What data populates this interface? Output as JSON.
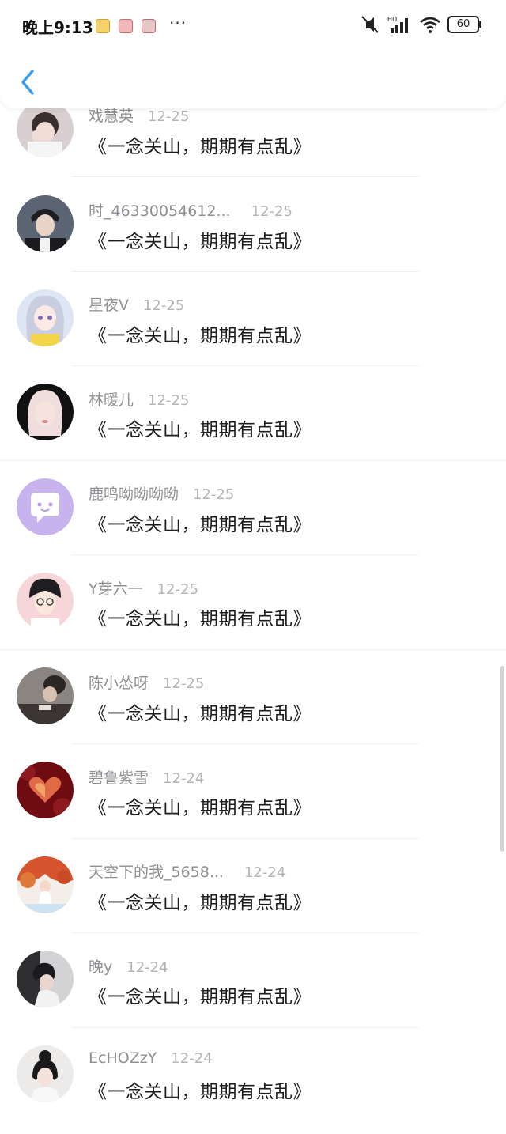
{
  "status_bar": {
    "time": "晚上9:13",
    "more": "···",
    "network": "HD",
    "battery": "60"
  },
  "header": {
    "back_icon": "chevron-left-icon",
    "accent": "#3a9be8"
  },
  "message_text": "《一念关山，期期有点乱》",
  "items": [
    {
      "name": "戏慧英",
      "date": "12-25",
      "message": "《一念关山，期期有点乱》",
      "avatar": "photo-person"
    },
    {
      "name": "时_46330054612...",
      "date": "12-25",
      "message": "《一念关山，期期有点乱》",
      "avatar": "photo-man"
    },
    {
      "name": "星夜V",
      "date": "12-25",
      "message": "《一念关山，期期有点乱》",
      "avatar": "anime-girl"
    },
    {
      "name": "林暖儿",
      "date": "12-25",
      "message": "《一念关山，期期有点乱》",
      "avatar": "photo-woman"
    },
    {
      "name": "鹿鸣呦呦呦呦",
      "date": "12-25",
      "message": "《一念关山，期期有点乱》",
      "avatar": "default-chat"
    },
    {
      "name": "Y芽六一",
      "date": "12-25",
      "message": "《一念关山，期期有点乱》",
      "avatar": "cartoon-boy"
    },
    {
      "name": "陈小怂呀",
      "date": "12-25",
      "message": "《一念关山，期期有点乱》",
      "avatar": "photo-hands"
    },
    {
      "name": "碧鲁紫雪",
      "date": "12-24",
      "message": "《一念关山，期期有点乱》",
      "avatar": "red-heart"
    },
    {
      "name": "天空下的我_5658...",
      "date": "12-24",
      "message": "《一念关山，期期有点乱》",
      "avatar": "autumn-girl"
    },
    {
      "name": "晚y",
      "date": "12-24",
      "message": "《一念关山，期期有点乱》",
      "avatar": "photo-dark"
    },
    {
      "name": "EcHOZzY",
      "date": "12-24",
      "message": "《一念关山，期期有点乱》",
      "avatar": "photo-bun"
    }
  ]
}
